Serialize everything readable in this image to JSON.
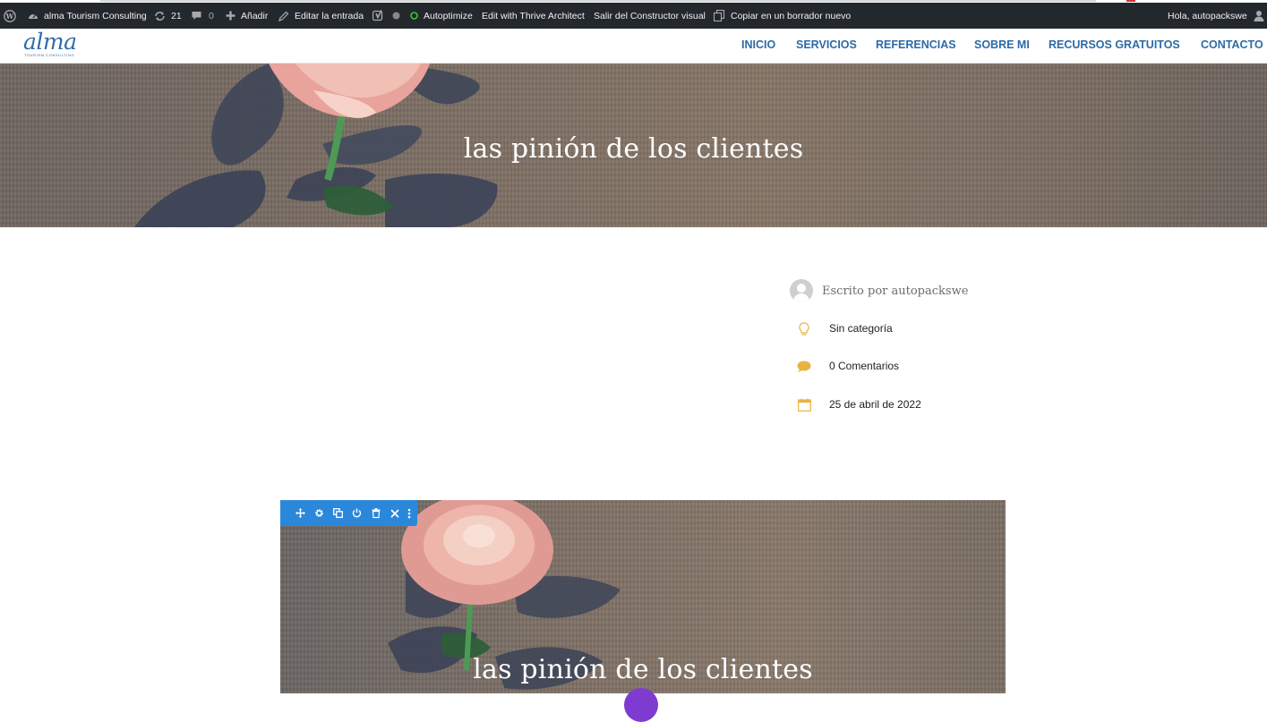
{
  "admin_bar": {
    "site_name": "alma Tourism Consulting",
    "updates_count": "21",
    "comments_count": "0",
    "new_label": "Añadir",
    "edit_label": "Editar la entrada",
    "autoptimize_label": "Autoptimize",
    "thrive_label": "Edit with Thrive Architect",
    "exit_builder_label": "Salir del Constructor visual",
    "copy_draft_label": "Copiar en un borrador nuevo",
    "greeting": "Hola, autopackswe"
  },
  "header": {
    "logo_text": "alma",
    "logo_tagline": "TOURISM CONSULTING",
    "nav": [
      "INICIO",
      "SERVICIOS",
      "REFERENCIAS",
      "SOBRE MI",
      "RECURSOS GRATUITOS",
      "CONTACTO"
    ]
  },
  "hero": {
    "title": "las pinión de los clientes"
  },
  "post_meta": {
    "author": "Escrito por autopackswe",
    "category": "Sin categoría",
    "comments": "0 Comentarios",
    "date": "25 de abril de 2022"
  },
  "builder_block": {
    "title": "las pinión de los clientes",
    "toolbar_icons": [
      "move-icon",
      "settings-icon",
      "duplicate-icon",
      "power-icon",
      "trash-icon",
      "close-icon",
      "more-icon"
    ]
  },
  "colors": {
    "admin_bar_bg": "#23282d",
    "nav_blue": "#2d6aa6",
    "meta_icon_gold": "#e8b341",
    "builder_toolbar_blue": "#2b87da",
    "autoptimize_green": "#33cc33"
  }
}
